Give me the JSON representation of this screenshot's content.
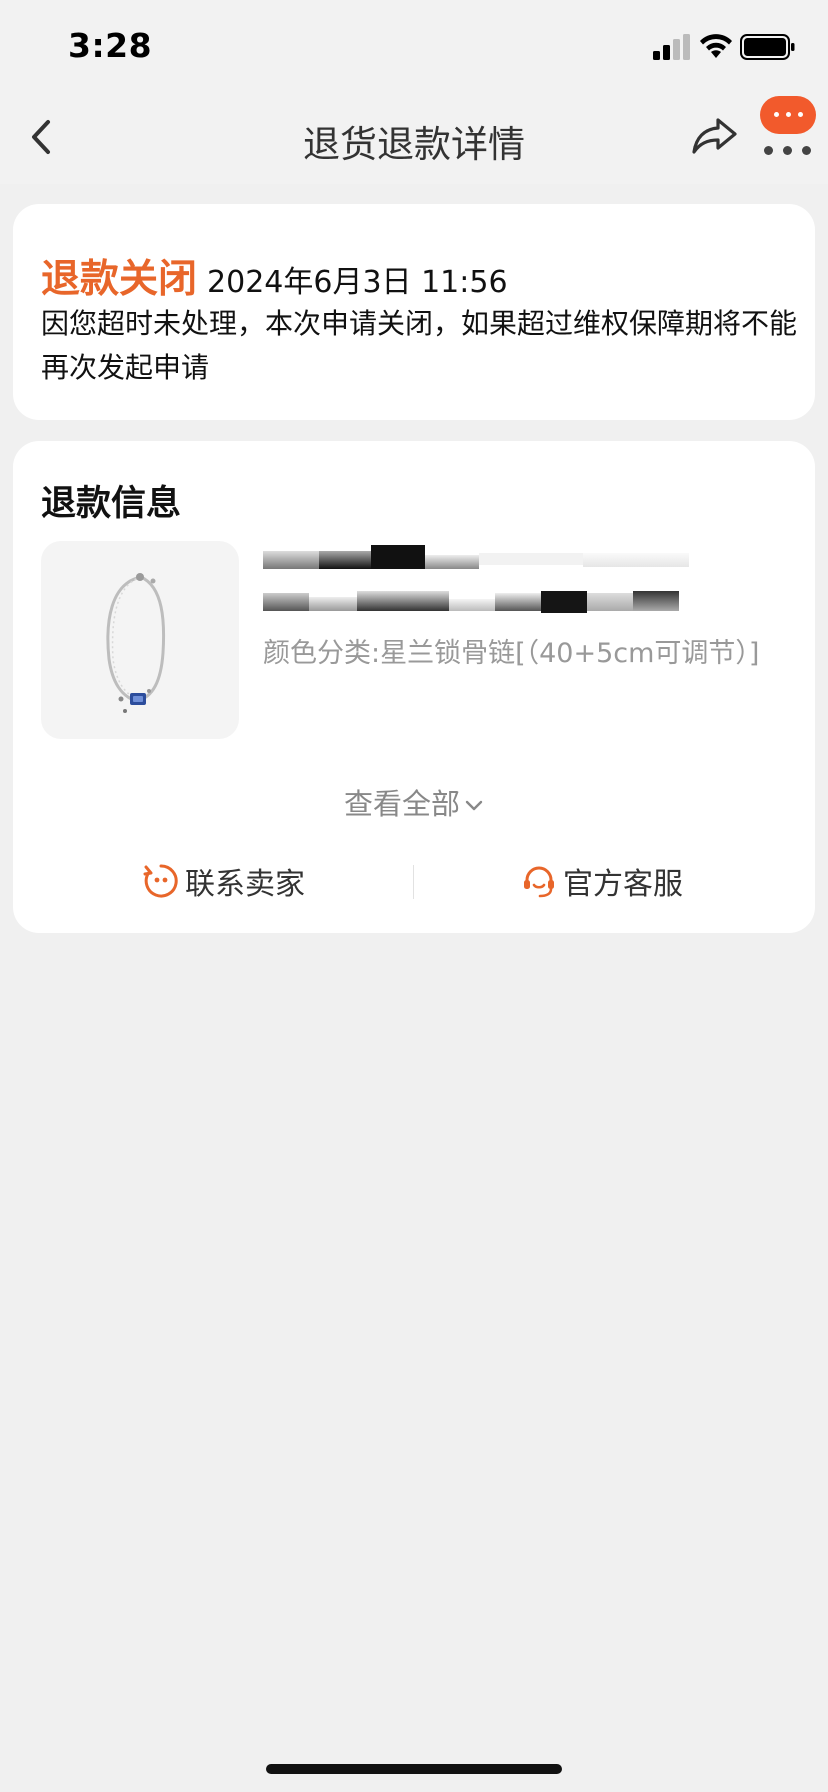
{
  "status_bar": {
    "time": "3:28"
  },
  "nav": {
    "title": "退货退款详情",
    "back_icon": "chevron-left-icon",
    "share_icon": "share-arrow-icon",
    "more_icon": "more-dots-icon",
    "message_icon": "message-bubble-icon"
  },
  "status_card": {
    "label": "退款关闭",
    "time": "2024年6月3日 11:56",
    "description": "因您超时未处理，本次申请关闭，如果超过维权保障期将不能再次发起申请"
  },
  "refund_info": {
    "title": "退款信息",
    "product": {
      "image_icon": "necklace-image",
      "sku": "颜色分类:星兰锁骨链[（40+5cm可调节）]"
    },
    "view_all": "查看全部",
    "actions": {
      "contact_seller": "联系卖家",
      "official_service": "官方客服"
    }
  },
  "colors": {
    "accent": "#e8662a",
    "badge": "#f25a2c",
    "background": "#f0f0f0"
  }
}
